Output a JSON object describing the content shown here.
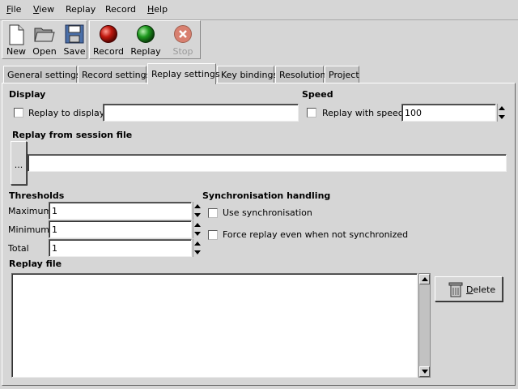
{
  "menubar": {
    "items": [
      {
        "label": "File",
        "mnemonic": "F"
      },
      {
        "label": "View",
        "mnemonic": "V"
      },
      {
        "label": "Replay",
        "mnemonic": ""
      },
      {
        "label": "Record",
        "mnemonic": ""
      },
      {
        "label": "Help",
        "mnemonic": "H"
      }
    ]
  },
  "toolbar": {
    "new": "New",
    "open": "Open",
    "save": "Save",
    "record": "Record",
    "replay": "Replay",
    "stop": "Stop",
    "colors": {
      "record": "#c0180e",
      "replay": "#1f9a1f",
      "stop": "#d88070"
    }
  },
  "tabs": [
    {
      "label": "General settings",
      "active": false
    },
    {
      "label": "Record settings",
      "active": false
    },
    {
      "label": "Replay settings",
      "active": true
    },
    {
      "label": "Key bindings",
      "active": false
    },
    {
      "label": "Resolution",
      "active": false
    },
    {
      "label": "Project",
      "active": false
    }
  ],
  "display": {
    "title": "Display",
    "replay_to_display_label": "Replay to display:",
    "replay_to_display_value": "",
    "checked": false
  },
  "speed": {
    "title": "Speed",
    "replay_with_speed_label": "Replay with speed:",
    "value": "100",
    "checked": false
  },
  "session": {
    "title": "Replay from session file",
    "browse_label": "...",
    "path_value": ""
  },
  "thresholds": {
    "title": "Thresholds",
    "maximum_label": "Maximum",
    "maximum_value": "1",
    "minimum_label": "Minimum",
    "minimum_value": "1",
    "total_label": "Total",
    "total_value": "1"
  },
  "sync": {
    "title": "Synchronisation handling",
    "use_sync_label": "Use synchronisation",
    "force_replay_label": "Force replay even when not synchronized",
    "use_sync_checked": false,
    "force_replay_checked": false
  },
  "replay_file": {
    "title": "Replay file",
    "items": [],
    "delete_label": "Delete",
    "delete_mnemonic": "D"
  }
}
